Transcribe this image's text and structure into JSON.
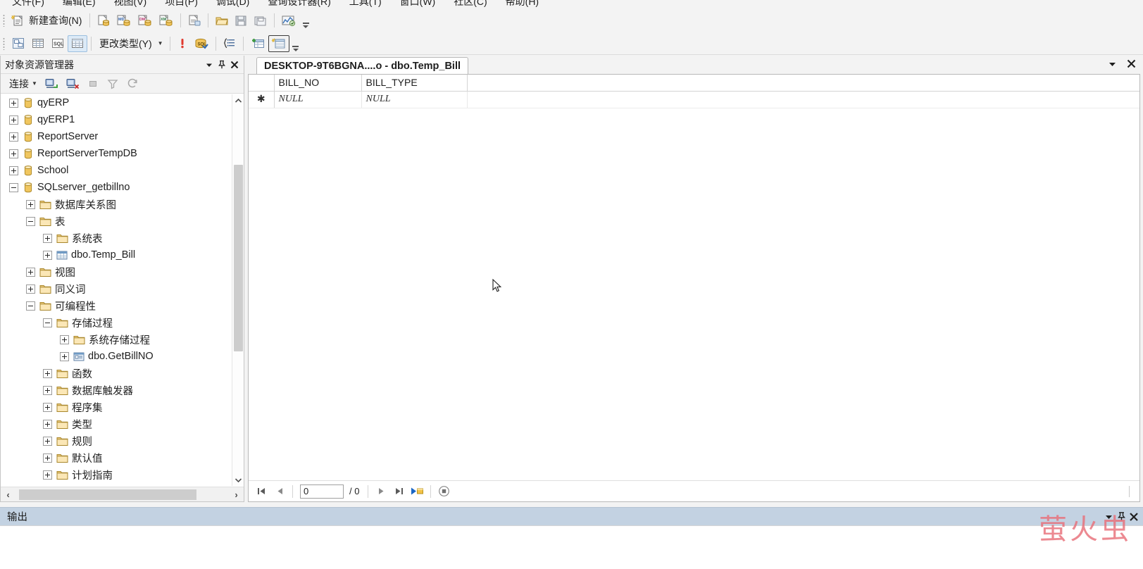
{
  "menu": {
    "items": [
      {
        "label": "文件(F)"
      },
      {
        "label": "编辑(E)"
      },
      {
        "label": "视图(V)"
      },
      {
        "label": "项目(P)"
      },
      {
        "label": "调试(D)"
      },
      {
        "label": "查询设计器(R)"
      },
      {
        "label": "工具(T)"
      },
      {
        "label": "窗口(W)"
      },
      {
        "label": "社区(C)"
      },
      {
        "label": "帮助(H)"
      }
    ]
  },
  "toolbar_primary": {
    "new_query_label": "新建查询(N)",
    "icons": [
      "new-query-icon",
      "new-database-engine-query-icon",
      "new-analysis-services-mdx-query-icon",
      "new-analysis-services-dmx-query-icon",
      "new-analysis-services-xmla-query-icon",
      "new-sql-server-compact-query-icon",
      "open-file-icon",
      "save-icon",
      "save-all-icon",
      "activity-monitor-icon"
    ]
  },
  "toolbar_secondary": {
    "change_type_label": "更改类型(Y)",
    "icons": [
      "show-diagram-pane-icon",
      "show-criteria-pane-icon",
      "show-sql-pane-icon",
      "show-results-pane-icon",
      "execute-sql-icon",
      "verify-sql-syntax-icon",
      "add-group-by-icon",
      "add-table-icon",
      "add-new-derived-table-icon"
    ]
  },
  "object_explorer": {
    "title": "对象资源管理器",
    "toolbar": {
      "connect_label": "连接",
      "icons": [
        "connect-icon",
        "disconnect-icon",
        "stop-icon",
        "filter-icon",
        "refresh-icon"
      ]
    },
    "title_buttons": [
      "window-position-dropdown-icon",
      "auto-hide-pin-icon",
      "close-icon"
    ],
    "tree": [
      {
        "label": "qyERP",
        "indent": 0,
        "icon": "database-icon",
        "state": "collapsed"
      },
      {
        "label": "qyERP1",
        "indent": 0,
        "icon": "database-icon",
        "state": "collapsed"
      },
      {
        "label": "ReportServer",
        "indent": 0,
        "icon": "database-icon",
        "state": "collapsed"
      },
      {
        "label": "ReportServerTempDB",
        "indent": 0,
        "icon": "database-icon",
        "state": "collapsed"
      },
      {
        "label": "School",
        "indent": 0,
        "icon": "database-icon",
        "state": "collapsed"
      },
      {
        "label": "SQLserver_getbillno",
        "indent": 0,
        "icon": "database-icon",
        "state": "expanded"
      },
      {
        "label": "数据库关系图",
        "indent": 1,
        "icon": "folder-icon",
        "state": "collapsed"
      },
      {
        "label": "表",
        "indent": 1,
        "icon": "folder-icon",
        "state": "expanded"
      },
      {
        "label": "系统表",
        "indent": 2,
        "icon": "folder-icon",
        "state": "collapsed"
      },
      {
        "label": "dbo.Temp_Bill",
        "indent": 2,
        "icon": "table-icon",
        "state": "collapsed"
      },
      {
        "label": "视图",
        "indent": 1,
        "icon": "folder-icon",
        "state": "collapsed"
      },
      {
        "label": "同义词",
        "indent": 1,
        "icon": "folder-icon",
        "state": "collapsed"
      },
      {
        "label": "可编程性",
        "indent": 1,
        "icon": "folder-icon",
        "state": "expanded"
      },
      {
        "label": "存储过程",
        "indent": 2,
        "icon": "folder-icon",
        "state": "expanded"
      },
      {
        "label": "系统存储过程",
        "indent": 3,
        "icon": "folder-icon",
        "state": "collapsed"
      },
      {
        "label": "dbo.GetBillNO",
        "indent": 3,
        "icon": "stored-procedure-icon",
        "state": "collapsed"
      },
      {
        "label": "函数",
        "indent": 2,
        "icon": "folder-icon",
        "state": "collapsed"
      },
      {
        "label": "数据库触发器",
        "indent": 2,
        "icon": "folder-icon",
        "state": "collapsed"
      },
      {
        "label": "程序集",
        "indent": 2,
        "icon": "folder-icon",
        "state": "collapsed"
      },
      {
        "label": "类型",
        "indent": 2,
        "icon": "folder-icon",
        "state": "collapsed"
      },
      {
        "label": "规则",
        "indent": 2,
        "icon": "folder-icon",
        "state": "collapsed"
      },
      {
        "label": "默认值",
        "indent": 2,
        "icon": "folder-icon",
        "state": "collapsed"
      },
      {
        "label": "计划指南",
        "indent": 2,
        "icon": "folder-icon",
        "state": "collapsed"
      }
    ]
  },
  "document": {
    "tab_title": "DESKTOP-9T6BGNA....o - dbo.Temp_Bill",
    "tab_buttons": [
      "tab-list-dropdown-icon",
      "close-document-icon"
    ],
    "grid": {
      "row_header_symbol": "✱",
      "columns": [
        "BILL_NO",
        "BILL_TYPE"
      ],
      "rows": [
        {
          "marker": "✱",
          "cells": [
            "NULL",
            "NULL"
          ]
        }
      ]
    },
    "navigator": {
      "current_row": "0",
      "total_label": "/ 0",
      "buttons": [
        "move-first-icon",
        "move-previous-icon",
        "move-next-icon",
        "move-last-icon",
        "add-new-row-icon",
        "stop-icon"
      ]
    }
  },
  "output": {
    "title": "输出",
    "title_buttons": [
      "window-position-dropdown-icon",
      "auto-hide-pin-icon",
      "close-icon"
    ],
    "content": ""
  },
  "watermark": {
    "text": "萤火虫"
  },
  "colors": {
    "chrome": "#f3f3f3",
    "output_header": "#c3d2e2",
    "accent_blue": "#2a6099",
    "folder_yellow": "#e8c170",
    "watermark_red": "#e8707a"
  }
}
